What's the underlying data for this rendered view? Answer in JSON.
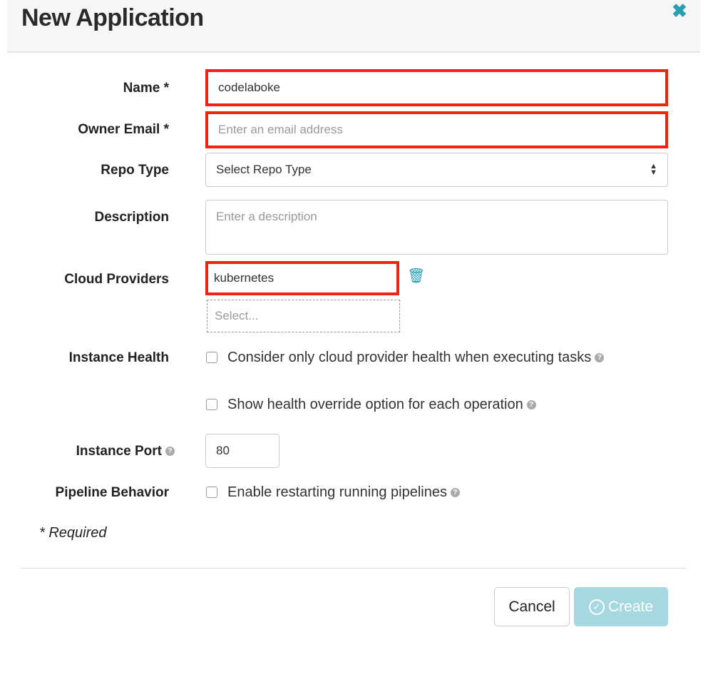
{
  "modal": {
    "title": "New Application",
    "close_icon": "close-icon"
  },
  "form": {
    "name": {
      "label": "Name *",
      "value": "codelaboke"
    },
    "email": {
      "label": "Owner Email *",
      "placeholder": "Enter an email address"
    },
    "repo_type": {
      "label": "Repo Type",
      "value": "Select Repo Type"
    },
    "description": {
      "label": "Description",
      "placeholder": "Enter a description"
    },
    "cloud_providers": {
      "label": "Cloud Providers",
      "selected": "kubernetes",
      "placeholder": "Select..."
    },
    "instance_health": {
      "label": "Instance Health",
      "option1": "Consider only cloud provider health when executing tasks",
      "option2": "Show health override option for each operation"
    },
    "instance_port": {
      "label": "Instance Port",
      "value": "80"
    },
    "pipeline_behavior": {
      "label": "Pipeline Behavior",
      "option": "Enable restarting running pipelines"
    },
    "required_note": "* Required"
  },
  "footer": {
    "cancel": "Cancel",
    "create": "Create"
  },
  "colors": {
    "accent": "#2a9db5",
    "error": "#f0230f",
    "create_disabled": "#a6d8e2"
  }
}
